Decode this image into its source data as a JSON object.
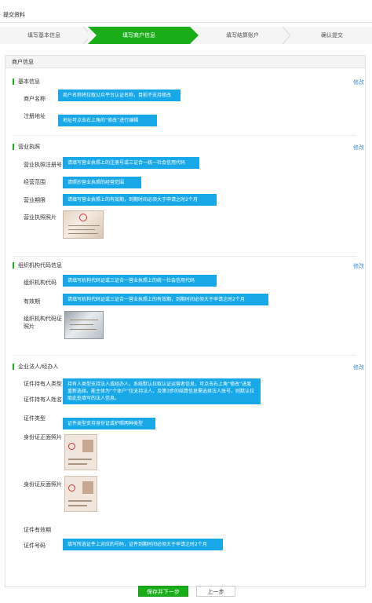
{
  "page": {
    "title": "提交资料"
  },
  "steps": [
    {
      "label": "填写基本信息",
      "active": false
    },
    {
      "label": "填写商户信息",
      "active": true
    },
    {
      "label": "填写结算账户",
      "active": false
    },
    {
      "label": "确认提交",
      "active": false
    }
  ],
  "panel": {
    "title": "商户信息"
  },
  "basic": {
    "title": "基本信息",
    "edit": "修改",
    "merchant_name_label": "商户名称",
    "merchant_name_note": "商户名称将拉取公众平台认证名称，目前不支持修改",
    "address_label": "注册地址",
    "address_note": "地址可点击右上角的“修改”进行编辑"
  },
  "license": {
    "title": "营业执照",
    "edit": "修改",
    "reg_no_label": "营业执照注册号",
    "reg_no_note": "请填写营业执照上的注册号或三证合一统一社会信用代码",
    "scope_label": "经营范围",
    "scope_note": "请照抄营业执照的经营范围",
    "period_label": "营业期限",
    "period_note": "请填写营业执照上的有效期，到期时间必须大于申请之时2个月",
    "photo_label": "营业执照照片"
  },
  "orgcode": {
    "title": "组织机构代码信息",
    "edit": "修改",
    "code_label": "组织机构代码",
    "code_note": "请填写机构代码证或三证合一营业执照上的统一社会信用代码",
    "valid_label": "有效期",
    "valid_note": "请填写机构代码证或三证合一营业执照上的有效期，到期时间必须大于申请之时2个月",
    "photo_label_1": "组织机构代码证",
    "photo_label_2": "照片"
  },
  "legal": {
    "title": "企业法人/经办人",
    "edit": "修改",
    "holder_type_label": "证件持有人类型",
    "holder_name_label": "证件持有人姓名",
    "holder_note": "持有人类型支持法人或经办人，系统默认拉取认证运营者信息，可点击右上角“修改”进度重新选择。能主体为“个体户”仅支持法人，及第3步的结算信息需选择法人账号，则默认拉取此处填写的法人信息。",
    "cert_type_label": "证件类型",
    "cert_type_note": "证件类型支持身份证或护照两种类型",
    "id_front_label": "身份证正面照片",
    "id_back_label": "身份证反面照片",
    "cert_valid_label": "证件有效期",
    "cert_no_label": "证件号码",
    "cert_no_note": "填写所选证件上对应的号码，证件到期时间必须大于申请之时2个月"
  },
  "actions": {
    "save_next": "保存并下一步",
    "prev": "上一步"
  },
  "colors": {
    "accent": "#1aad19",
    "note_bg": "#18a8e8",
    "link": "#3b8fd6"
  }
}
